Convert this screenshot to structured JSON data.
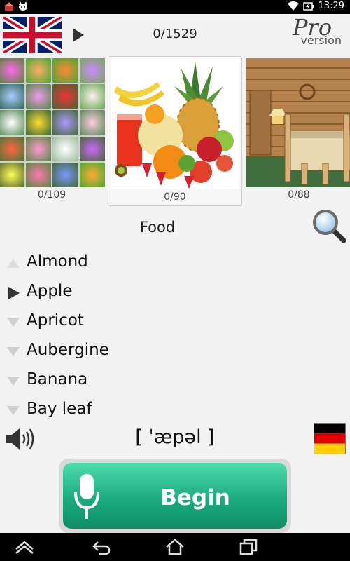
{
  "status_bar": {
    "time": "13:29",
    "icons": [
      "app-notification-icon",
      "cat-notification-icon",
      "wifi-icon",
      "battery-icon"
    ]
  },
  "header": {
    "source_language_flag": "uk-flag-icon",
    "counter": "0/1529",
    "pro_text": "Pro",
    "version_text": "version"
  },
  "categories": [
    {
      "name": "flowers",
      "count": "0/109"
    },
    {
      "name": "food",
      "count": "0/90"
    },
    {
      "name": "bedroom",
      "count": "0/88"
    }
  ],
  "current_category": "Food",
  "words": [
    {
      "label": "Almond",
      "state": "faded"
    },
    {
      "label": "Apple",
      "state": "selected"
    },
    {
      "label": "Apricot",
      "state": "default"
    },
    {
      "label": "Aubergine",
      "state": "default"
    },
    {
      "label": "Banana",
      "state": "default"
    },
    {
      "label": "Bay leaf",
      "state": "default"
    }
  ],
  "pronunciation": "[ ˈæpəl ]",
  "target_language_flag": "germany-flag-icon",
  "begin_label": "Begin",
  "colors": {
    "begin_top": "#4fdcae",
    "begin_bottom": "#0f8d65",
    "background": "#f2f2f2"
  },
  "nav_bar": [
    "home-icon",
    "back-icon",
    "home-screen-icon",
    "recent-apps-icon"
  ]
}
